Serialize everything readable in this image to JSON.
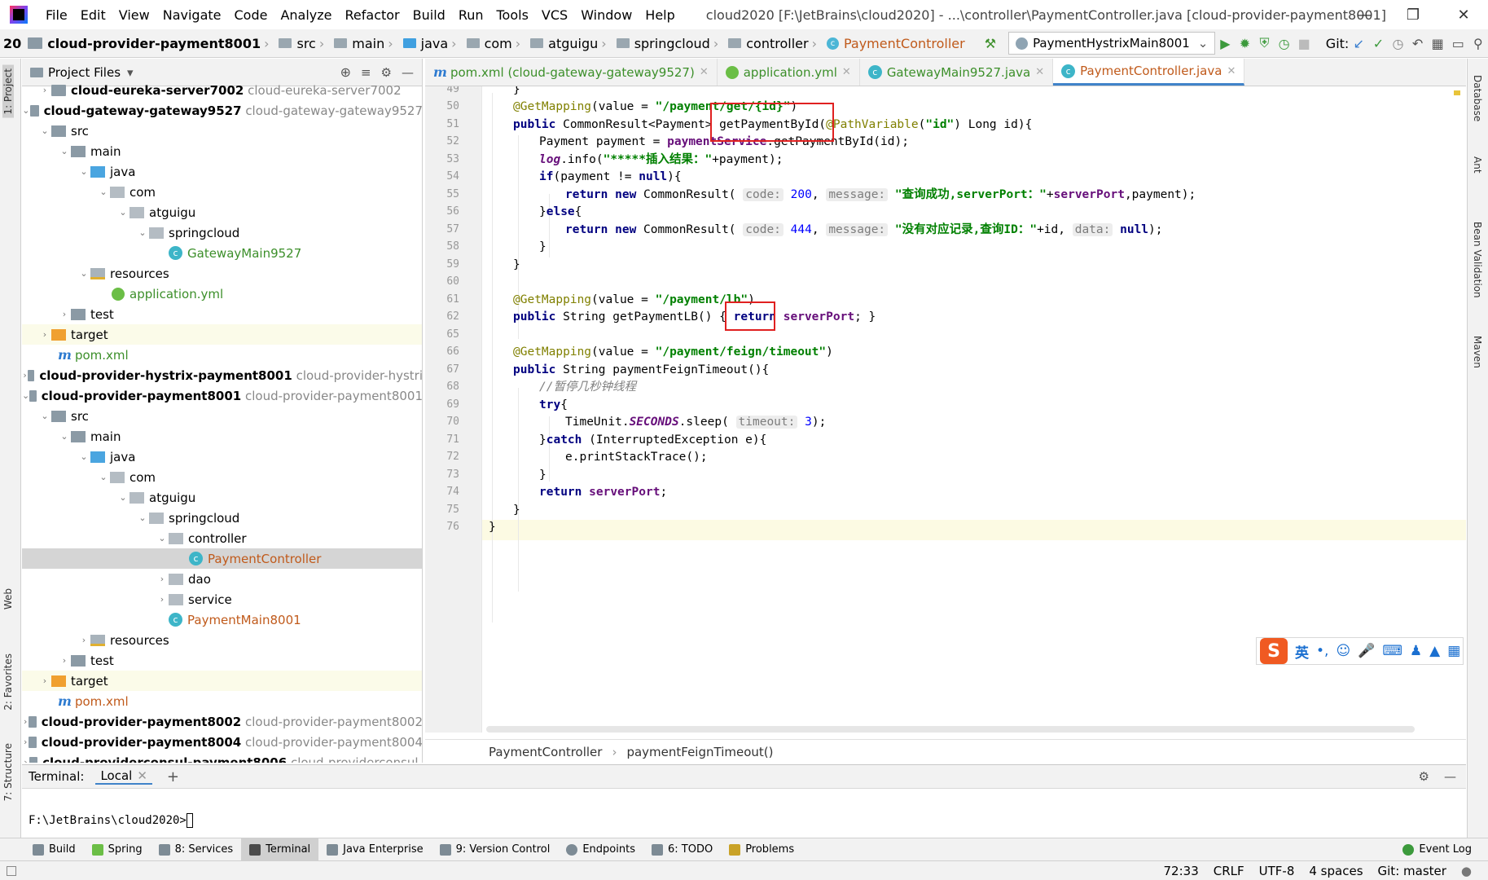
{
  "menubar": {
    "items": [
      "File",
      "Edit",
      "View",
      "Navigate",
      "Code",
      "Analyze",
      "Refactor",
      "Build",
      "Run",
      "Tools",
      "VCS",
      "Window",
      "Help"
    ],
    "window_title": "cloud2020 [F:\\JetBrains\\cloud2020] - ...\\controller\\PaymentController.java [cloud-provider-payment8001]"
  },
  "navbar": {
    "crumbs": [
      "20",
      "cloud-provider-payment8001",
      "src",
      "main",
      "java",
      "com",
      "atguigu",
      "springcloud",
      "controller",
      "PaymentController"
    ],
    "run_config": "PaymentHystrixMain8001",
    "git_label": "Git:"
  },
  "project_panel": {
    "title": "Project Files",
    "rows": [
      {
        "name": "cloud-eureka-server7002",
        "extra": "cloud-eureka-server7002"
      },
      {
        "name": "cloud-gateway-gateway9527",
        "extra": "cloud-gateway-gateway9527"
      },
      {
        "name": "src"
      },
      {
        "name": "main"
      },
      {
        "name": "java"
      },
      {
        "name": "com"
      },
      {
        "name": "atguigu"
      },
      {
        "name": "springcloud"
      },
      {
        "name": "GatewayMain9527"
      },
      {
        "name": "resources"
      },
      {
        "name": "application.yml"
      },
      {
        "name": "test"
      },
      {
        "name": "target"
      },
      {
        "name": "pom.xml"
      },
      {
        "name": "cloud-provider-hystrix-payment8001",
        "extra": "cloud-provider-hystri"
      },
      {
        "name": "cloud-provider-payment8001",
        "extra": "cloud-provider-payment8001"
      },
      {
        "name": "src"
      },
      {
        "name": "main"
      },
      {
        "name": "java"
      },
      {
        "name": "com"
      },
      {
        "name": "atguigu"
      },
      {
        "name": "springcloud"
      },
      {
        "name": "controller"
      },
      {
        "name": "PaymentController"
      },
      {
        "name": "dao"
      },
      {
        "name": "service"
      },
      {
        "name": "PaymentMain8001"
      },
      {
        "name": "resources"
      },
      {
        "name": "test"
      },
      {
        "name": "target"
      },
      {
        "name": "pom.xml"
      },
      {
        "name": "cloud-provider-payment8002",
        "extra": "cloud-provider-payment8002"
      },
      {
        "name": "cloud-provider-payment8004",
        "extra": "cloud-provider-payment8004"
      },
      {
        "name": "cloud-providerconsul-payment8006",
        "extra": "cloud-providerconsul-"
      }
    ]
  },
  "tabs": [
    {
      "label": "pom.xml (cloud-gateway-gateway9527)"
    },
    {
      "label": "application.yml"
    },
    {
      "label": "GatewayMain9527.java"
    },
    {
      "label": "PaymentController.java"
    }
  ],
  "editor": {
    "line_numbers": [
      "49",
      "50",
      "51",
      "52",
      "53",
      "54",
      "55",
      "56",
      "57",
      "58",
      "59",
      "60",
      "61",
      "62",
      "65",
      "66",
      "67",
      "68",
      "69",
      "70",
      "71",
      "72",
      "73",
      "74",
      "75",
      "76"
    ],
    "breadcrumb": [
      "PaymentController",
      "paymentFeignTimeout()"
    ],
    "code": {
      "l49": "}",
      "l50_ann": "@GetMapping",
      "l50_a": "(value = ",
      "l50_str": "\"/payment/get/{id}\"",
      "l50_b": ")",
      "l51_kw": "public",
      "l51_a": " CommonResult<Payment> getPaymentById(",
      "l51_ann": "@PathVariable",
      "l51_b": "(",
      "l51_str": "\"id\"",
      "l51_c": ") Long id){",
      "l52_a": "Payment payment = ",
      "l52_fld": "paymentService",
      "l52_b": ".getPaymentById(id);",
      "l53_log": "log",
      "l53_a": ".info(",
      "l53_str": "\"*****插入结果：\"",
      "l53_b": "+payment);",
      "l54_kw": "if",
      "l54_a": "(payment != ",
      "l54_kw2": "null",
      "l54_b": "){",
      "l55_kw": "return new",
      "l55_a": " CommonResult(",
      "l55_h1": "code:",
      "l55_n1": "200",
      "l55_h2": "message:",
      "l55_str": "\"查询成功,serverPort：\"",
      "l55_b": "+",
      "l55_fld": "serverPort",
      "l55_c": ",payment);",
      "l56_a": "}",
      "l56_kw": "else",
      "l56_b": "{",
      "l57_kw": "return new",
      "l57_a": " CommonResult(",
      "l57_h1": "code:",
      "l57_n1": "444",
      "l57_h2": "message:",
      "l57_str": "\"没有对应记录,查询ID：\"",
      "l57_b": "+id, ",
      "l57_h3": "data:",
      "l57_kw2": "null",
      "l57_c": ");",
      "l58": "}",
      "l59": "}",
      "l61_ann": "@GetMapping",
      "l61_a": "(value = ",
      "l61_str": "\"/payment/lb\"",
      "l61_b": ")",
      "l62_kw": "public",
      "l62_a": " String getPaymentLB() { ",
      "l62_kw2": "return",
      "l62_sp": " ",
      "l62_fld": "serverPort",
      "l62_b": "; }",
      "l66_ann": "@GetMapping",
      "l66_a": "(value = ",
      "l66_str": "\"/payment/feign/timeout\"",
      "l66_b": ")",
      "l67_kw": "public",
      "l67_a": " String paymentFeignTimeout(){",
      "l68_cmt": "//暂停几秒钟线程",
      "l69_kw": "try",
      "l69_a": "{",
      "l70_a": "TimeUnit.",
      "l70_it": "SECONDS",
      "l70_b": ".sleep(",
      "l70_h": "timeout:",
      "l70_n": "3",
      "l70_c": ");",
      "l71_a": "}",
      "l71_kw": "catch",
      "l71_b": " (InterruptedException e){",
      "l72": "e.printStackTrace();",
      "l73": "}",
      "l74_kw": "return",
      "l74_sp": " ",
      "l74_fld": "serverPort",
      "l74_a": ";",
      "l75": "}",
      "l76": "}"
    }
  },
  "terminal": {
    "label": "Terminal:",
    "tab": "Local",
    "prompt": "F:\\JetBrains\\cloud2020>"
  },
  "bottom_tools": [
    {
      "label": "Build"
    },
    {
      "label": "Spring"
    },
    {
      "label": "8: Services"
    },
    {
      "label": "Terminal"
    },
    {
      "label": "Java Enterprise"
    },
    {
      "label": "9: Version Control"
    },
    {
      "label": "Endpoints"
    },
    {
      "label": "6: TODO"
    },
    {
      "label": "Problems"
    },
    {
      "label": "Event Log"
    }
  ],
  "statusbar": {
    "position": "72:33",
    "line_sep": "CRLF",
    "encoding": "UTF-8",
    "indent": "4 spaces",
    "vcs": "Git: master"
  },
  "side_tabs": {
    "left": [
      "1: Project",
      "Web",
      "2: Favorites",
      "7: Structure"
    ],
    "right": [
      "Database",
      "Ant",
      "Bean Validation",
      "Maven"
    ]
  },
  "ime": {
    "logo": "S",
    "lang": "英"
  },
  "colors": {
    "annotation": "#808000",
    "keyword": "#000080",
    "string": "#008000",
    "field": "#660e7a",
    "highlight_box": "#e02020"
  }
}
